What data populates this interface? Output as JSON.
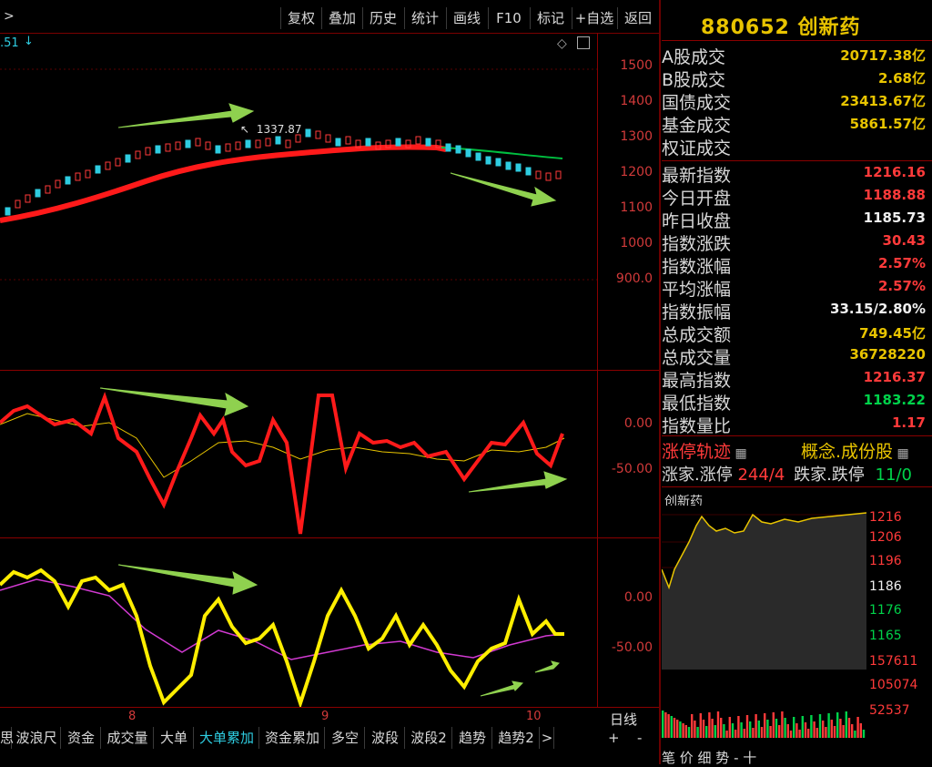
{
  "toolbar": {
    "back_arrow": ">",
    "buttons": [
      "复权",
      "叠加",
      "历史",
      "统计",
      "画线",
      "F10",
      "标记",
      "+自选",
      "返回"
    ]
  },
  "price_chart": {
    "prev_value": ".51",
    "annotation": "1337.87",
    "y_ticks": [
      "1500",
      "1400",
      "1300",
      "1200",
      "1100",
      "1000",
      "900.0"
    ]
  },
  "indicator1": {
    "y_ticks": [
      "0.00",
      "-50.00"
    ]
  },
  "indicator2": {
    "y_ticks": [
      "0.00",
      "-50.00"
    ]
  },
  "x_labels": [
    "8",
    "9",
    "10"
  ],
  "period": "日线",
  "period_buttons": [
    "+",
    "-"
  ],
  "bottom_tabs": [
    "思",
    "波浪尺",
    "资金",
    "成交量",
    "大单",
    "大单累加",
    "资金累加",
    "多空",
    "波段",
    "波段2",
    "趋势",
    "趋势2",
    ">"
  ],
  "active_tab": "大单累加",
  "header": {
    "code": "880652",
    "name": "创新药"
  },
  "stats": [
    {
      "label": "A股成交",
      "value": "20717.38亿",
      "color": "#e8c400"
    },
    {
      "label": "B股成交",
      "value": "2.68亿",
      "color": "#e8c400"
    },
    {
      "label": "国债成交",
      "value": "23413.67亿",
      "color": "#e8c400"
    },
    {
      "label": "基金成交",
      "value": "5861.57亿",
      "color": "#e8c400"
    },
    {
      "label": "权证成交",
      "value": "",
      "color": "#e8c400"
    },
    {
      "label": "最新指数",
      "value": "1216.16",
      "color": "#ff3a3a"
    },
    {
      "label": "今日开盘",
      "value": "1188.88",
      "color": "#ff3a3a"
    },
    {
      "label": "昨日收盘",
      "value": "1185.73",
      "color": "#f0f0f0"
    },
    {
      "label": "指数涨跌",
      "value": "30.43",
      "color": "#ff3a3a"
    },
    {
      "label": "指数涨幅",
      "value": "2.57%",
      "color": "#ff3a3a"
    },
    {
      "label": "平均涨幅",
      "value": "2.57%",
      "color": "#ff3a3a"
    },
    {
      "label": "指数振幅",
      "value": "33.15/2.80%",
      "color": "#f0f0f0"
    },
    {
      "label": "总成交额",
      "value": "749.45亿",
      "color": "#e8c400"
    },
    {
      "label": "总成交量",
      "value": "36728220",
      "color": "#e8c400"
    },
    {
      "label": "最高指数",
      "value": "1216.37",
      "color": "#ff3a3a"
    },
    {
      "label": "最低指数",
      "value": "1183.22",
      "color": "#00d24a"
    },
    {
      "label": "指数量比",
      "value": "1.17",
      "color": "#ff3a3a"
    }
  ],
  "limit": {
    "title": "涨停轨迹",
    "concept": "概念.成份股",
    "up_label": "涨家.涨停",
    "up_value": "244/4",
    "down_label": "跌家.跌停",
    "down_value": "11/0"
  },
  "mini_chart": {
    "title": "创新药",
    "price_ticks": [
      {
        "v": "1216",
        "c": "#ff3a3a"
      },
      {
        "v": "1206",
        "c": "#ff3a3a"
      },
      {
        "v": "1196",
        "c": "#ff3a3a"
      },
      {
        "v": "1186",
        "c": "#f0f0f0"
      },
      {
        "v": "1176",
        "c": "#00d24a"
      },
      {
        "v": "1165",
        "c": "#00d24a"
      }
    ],
    "volume_ticks": [
      "157611",
      "105074",
      "52537"
    ]
  },
  "bottom_right_tabs": "笔   价   细   势   -   十",
  "colors": {
    "up": "#ff3a3a",
    "down": "#2ecce0",
    "ma": "#00c040",
    "arrow": "#8fd14f",
    "yellow": "#ffee00",
    "magenta": "#d23ad2"
  }
}
